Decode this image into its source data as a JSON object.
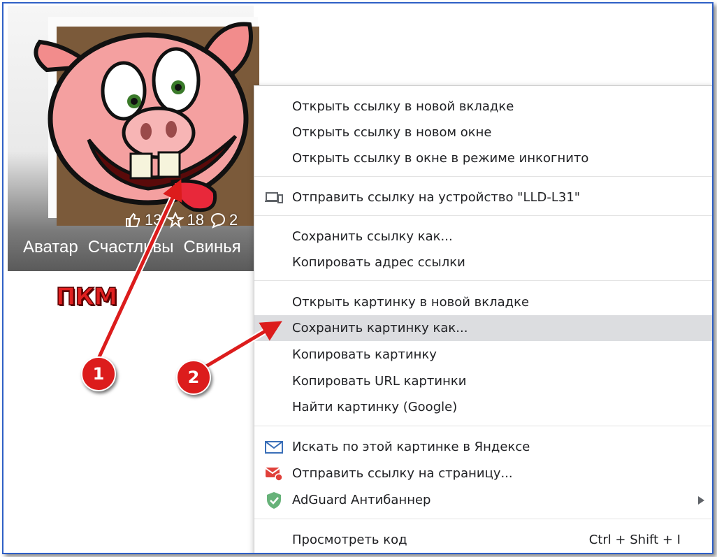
{
  "image_card": {
    "likes": "13",
    "favorites": "18",
    "comments": "2",
    "tags": [
      "Аватар",
      "Счастливы",
      "Свинья"
    ]
  },
  "annotation": {
    "pkm_label": "ПКМ",
    "step1": "1",
    "step2": "2",
    "arrow_color": "#dc1c1c"
  },
  "context_menu": {
    "open_link_new_tab": "Открыть ссылку в новой вкладке",
    "open_link_new_window": "Открыть ссылку в новом окне",
    "open_link_incognito": "Открыть ссылку в окне в режиме инкогнито",
    "send_to_device": "Отправить ссылку на устройство \"LLD-L31\"",
    "save_link_as": "Сохранить ссылку как...",
    "copy_link_address": "Копировать адрес ссылки",
    "open_image_new_tab": "Открыть картинку в новой вкладке",
    "save_image_as": "Сохранить картинку как...",
    "copy_image": "Копировать картинку",
    "copy_image_url": "Копировать URL картинки",
    "find_image_google": "Найти картинку (Google)",
    "search_yandex": "Искать по этой картинке в Яндексе",
    "send_link_to_page": "Отправить ссылку на страницу...",
    "adguard": "AdGuard Антибаннер",
    "view_code": "Просмотреть код",
    "view_code_shortcut": "Ctrl + Shift + I",
    "highlight_color": "#dcdde0"
  },
  "icons": {
    "device": "device-icon",
    "mail": "mail-icon",
    "mail_share": "mail-share-icon",
    "adguard": "adguard-shield-icon",
    "submenu": "submenu-arrow-icon"
  }
}
